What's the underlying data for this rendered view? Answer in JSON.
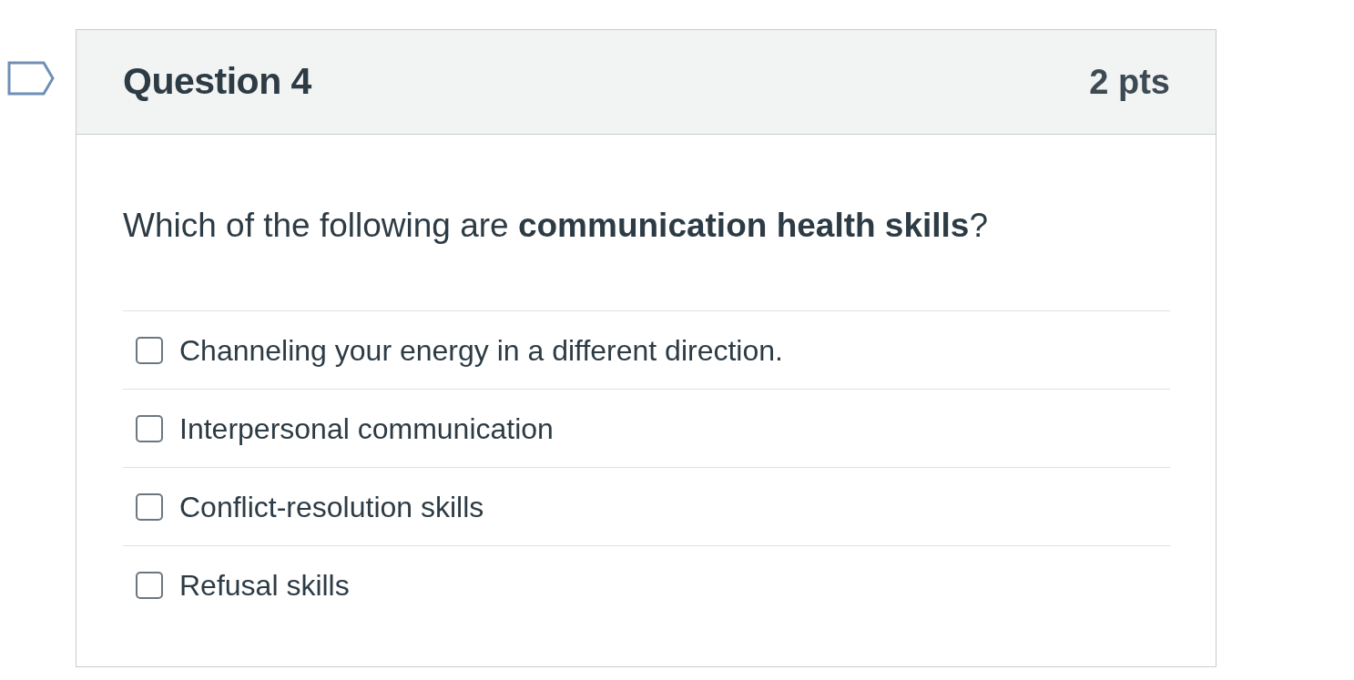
{
  "question": {
    "title": "Question 4",
    "points": "2 pts",
    "flagged": false,
    "text": "Which of the following are **communication health skills**?",
    "answers": [
      {
        "label": "Channeling your energy in a different direction.",
        "checked": false
      },
      {
        "label": "Interpersonal communication",
        "checked": false
      },
      {
        "label": "Conflict-resolution skills",
        "checked": false
      },
      {
        "label": "Refusal skills",
        "checked": false
      }
    ]
  }
}
